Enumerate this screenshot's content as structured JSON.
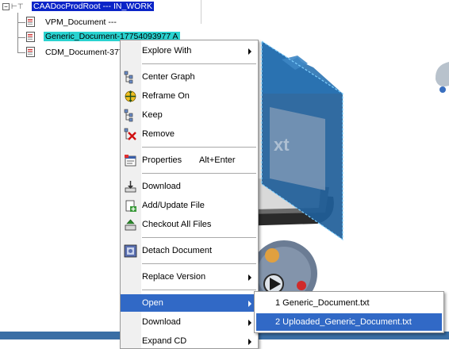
{
  "tree": {
    "root_label": "CAADocProdRoot --- IN_WORK",
    "children": [
      {
        "label": "VPM_Document ---"
      },
      {
        "label": "Generic_Document-17754093977 A"
      },
      {
        "label": "CDM_Document-377"
      }
    ]
  },
  "context_menu": {
    "items": [
      {
        "label": "Explore With",
        "icon": "none",
        "submenu": true
      },
      {
        "label": "Center Graph",
        "icon": "center-graph-icon"
      },
      {
        "label": "Reframe On",
        "icon": "reframe-icon"
      },
      {
        "label": "Keep",
        "icon": "keep-icon"
      },
      {
        "label": "Remove",
        "icon": "remove-icon"
      },
      {
        "label": "Properties",
        "shortcut": "Alt+Enter",
        "icon": "properties-icon"
      },
      {
        "label": "Download",
        "icon": "download-icon"
      },
      {
        "label": "Add/Update File",
        "icon": "add-file-icon"
      },
      {
        "label": "Checkout All Files",
        "icon": "checkout-icon"
      },
      {
        "label": "Detach Document",
        "icon": "detach-icon"
      },
      {
        "label": "Replace Version",
        "icon": "none",
        "submenu": true
      },
      {
        "label": "Open",
        "icon": "none",
        "submenu": true,
        "highlighted": true
      },
      {
        "label": "Download",
        "icon": "none",
        "submenu": true
      },
      {
        "label": "Expand CD",
        "icon": "none",
        "submenu": true
      }
    ]
  },
  "submenu": {
    "items": [
      {
        "label": "1 Generic_Document.txt"
      },
      {
        "label": "2 Uploaded_Generic_Document.txt",
        "highlighted": true
      }
    ]
  },
  "colors": {
    "highlight": "#3169c6",
    "root_selection": "#0a24c8",
    "doc_selection": "#29d3d0"
  }
}
